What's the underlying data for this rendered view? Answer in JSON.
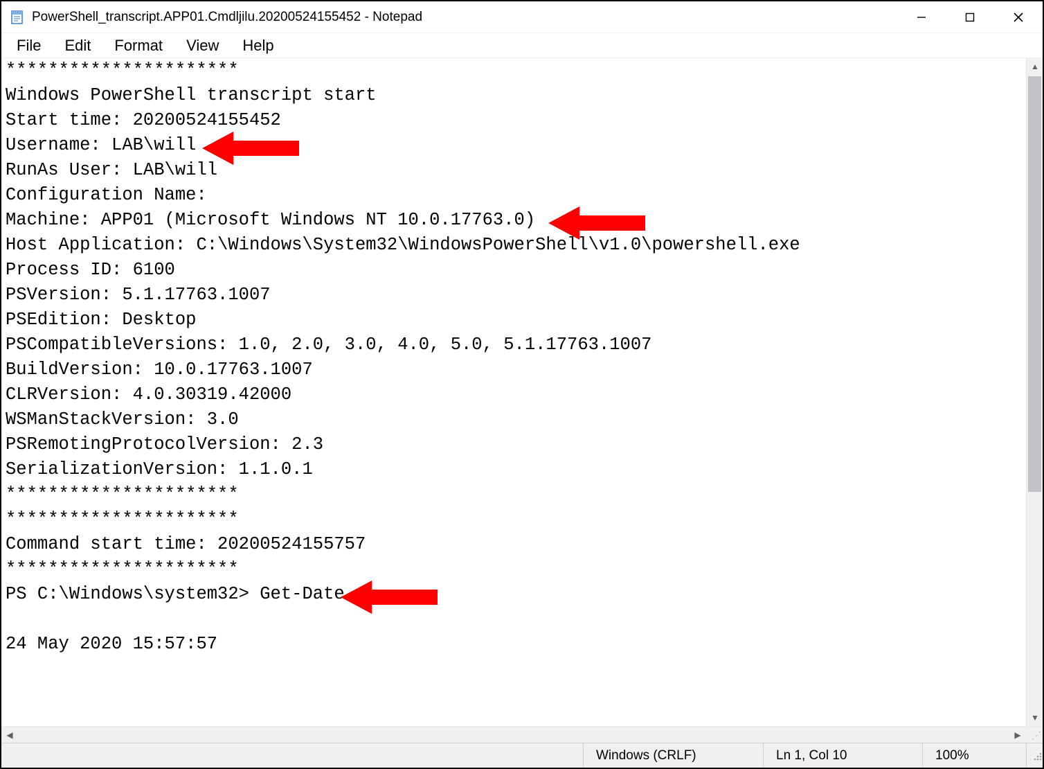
{
  "window": {
    "title": "PowerShell_transcript.APP01.Cmdljilu.20200524155452 - Notepad"
  },
  "menu": {
    "file": "File",
    "edit": "Edit",
    "format": "Format",
    "view": "View",
    "help": "Help"
  },
  "content": {
    "lines": [
      "**********************",
      "Windows PowerShell transcript start",
      "Start time: 20200524155452",
      "Username: LAB\\will",
      "RunAs User: LAB\\will",
      "Configuration Name:",
      "Machine: APP01 (Microsoft Windows NT 10.0.17763.0)",
      "Host Application: C:\\Windows\\System32\\WindowsPowerShell\\v1.0\\powershell.exe",
      "Process ID: 6100",
      "PSVersion: 5.1.17763.1007",
      "PSEdition: Desktop",
      "PSCompatibleVersions: 1.0, 2.0, 3.0, 4.0, 5.0, 5.1.17763.1007",
      "BuildVersion: 10.0.17763.1007",
      "CLRVersion: 4.0.30319.42000",
      "WSManStackVersion: 3.0",
      "PSRemotingProtocolVersion: 2.3",
      "SerializationVersion: 1.1.0.1",
      "**********************",
      "**********************",
      "Command start time: 20200524155757",
      "**********************",
      "PS C:\\Windows\\system32> Get-Date",
      "",
      "24 May 2020 15:57:57",
      ""
    ]
  },
  "status": {
    "line_ending": "Windows (CRLF)",
    "position": "Ln 1, Col 10",
    "zoom": "100%"
  },
  "annotation_color": "#ff0000"
}
